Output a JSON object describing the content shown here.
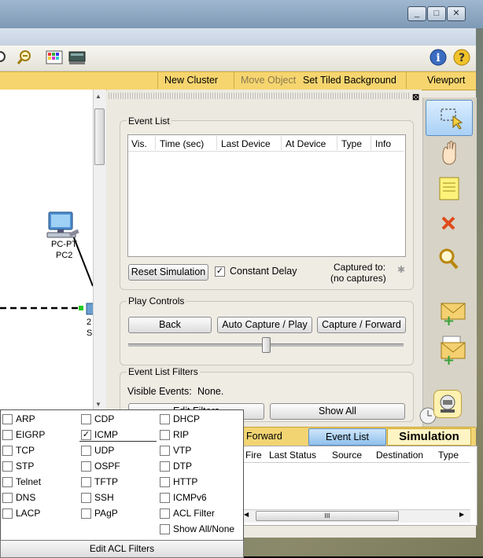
{
  "window": {
    "buttons": [
      "_",
      "□",
      "✕"
    ]
  },
  "toolbar_sub": {
    "new_cluster": "New Cluster",
    "move_object": "Move Object",
    "set_tiled_background": "Set Tiled Background",
    "viewport": "Viewport"
  },
  "workspace": {
    "device_name": "PC-PT",
    "device_label": "PC2",
    "switch_partial_1": "2",
    "switch_partial_2": "S"
  },
  "simulation": {
    "event_list_title": "Event List",
    "columns": [
      "Vis.",
      "Time (sec)",
      "Last Device",
      "At Device",
      "Type",
      "Info"
    ],
    "reset_button": "Reset Simulation",
    "constant_delay_label": "Constant Delay",
    "constant_delay_checked": true,
    "captured_to_label": "Captured to:",
    "captured_value": "(no captures)",
    "play_controls_title": "Play Controls",
    "back_button": "Back",
    "auto_capture_button": "Auto Capture / Play",
    "capture_forward_button": "Capture / Forward",
    "event_list_filters_title": "Event List Filters",
    "visible_events_label": "Visible Events:",
    "visible_events_value": "None.",
    "edit_filters_button": "Edit Filters",
    "show_all_button": "Show All"
  },
  "bottom_bar": {
    "forward_label": "Forward",
    "event_list_tab": "Event List",
    "simulation_tab": "Simulation"
  },
  "pdu_table": {
    "columns": [
      "Fire",
      "Last Status",
      "Source",
      "Destination",
      "Type"
    ]
  },
  "filters": {
    "col1": [
      {
        "label": "ARP",
        "checked": false
      },
      {
        "label": "EIGRP",
        "checked": false
      },
      {
        "label": "TCP",
        "checked": false
      },
      {
        "label": "STP",
        "checked": false
      },
      {
        "label": "Telnet",
        "checked": false
      },
      {
        "label": "DNS",
        "checked": false
      },
      {
        "label": "LACP",
        "checked": false
      }
    ],
    "col2": [
      {
        "label": "CDP",
        "checked": false
      },
      {
        "label": "ICMP",
        "checked": true
      },
      {
        "label": "UDP",
        "checked": false
      },
      {
        "label": "OSPF",
        "checked": false
      },
      {
        "label": "TFTP",
        "checked": false
      },
      {
        "label": "SSH",
        "checked": false
      },
      {
        "label": "PAgP",
        "checked": false
      }
    ],
    "col3": [
      {
        "label": "DHCP",
        "checked": false
      },
      {
        "label": "RIP",
        "checked": false
      },
      {
        "label": "VTP",
        "checked": false
      },
      {
        "label": "DTP",
        "checked": false
      },
      {
        "label": "HTTP",
        "checked": false
      },
      {
        "label": "ICMPv6",
        "checked": false
      },
      {
        "label": "ACL Filter",
        "checked": false
      },
      {
        "label": "Show All/None",
        "checked": false
      }
    ],
    "edit_acl_button": "Edit ACL Filters"
  },
  "colors": {
    "accent_yellow": "#f6d56f",
    "simulation_tab": "#fff2b8",
    "event_list_tab": "#9fc8ef",
    "link_green": "#22cc22"
  }
}
